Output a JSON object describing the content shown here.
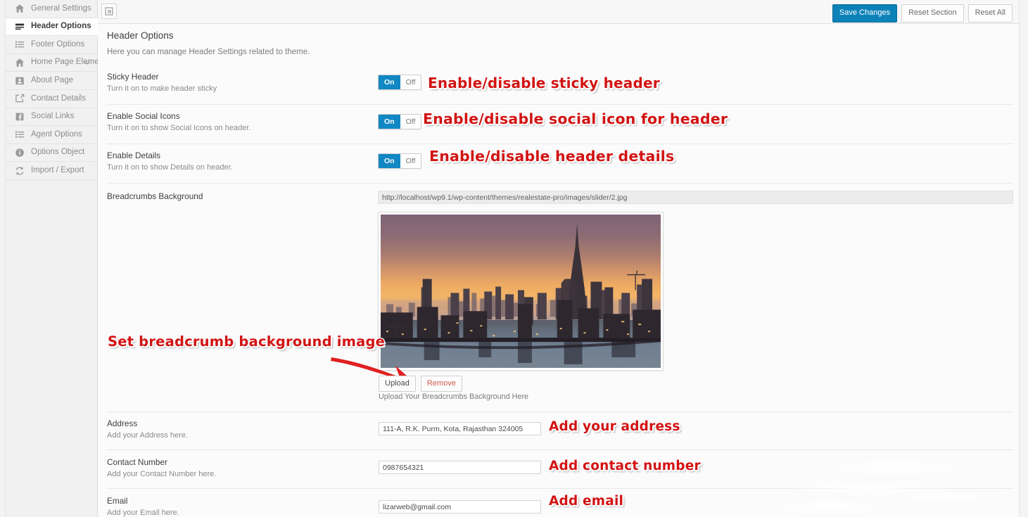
{
  "sidebar": {
    "items": [
      {
        "label": "General Settings",
        "icon": "home-icon",
        "active": false,
        "chevron": false
      },
      {
        "label": "Header Options",
        "icon": "header-bars-icon",
        "active": true,
        "chevron": false
      },
      {
        "label": "Footer Options",
        "icon": "list-icon",
        "active": false,
        "chevron": false
      },
      {
        "label": "Home Page Element",
        "icon": "home-icon",
        "active": false,
        "chevron": true
      },
      {
        "label": "About Page",
        "icon": "id-card-icon",
        "active": false,
        "chevron": false
      },
      {
        "label": "Contact Details",
        "icon": "edit-square-icon",
        "active": false,
        "chevron": false
      },
      {
        "label": "Social Links",
        "icon": "facebook-icon",
        "active": false,
        "chevron": false
      },
      {
        "label": "Agent Options",
        "icon": "list-icon",
        "active": false,
        "chevron": false
      },
      {
        "label": "Options Object",
        "icon": "info-circle-icon",
        "active": false,
        "chevron": false
      },
      {
        "label": "Import / Export",
        "icon": "refresh-icon",
        "active": false,
        "chevron": false
      }
    ]
  },
  "topbar": {
    "expand_icon": "panel-square-icon",
    "save_label": "Save Changes",
    "reset_section_label": "Reset Section",
    "reset_all_label": "Reset All"
  },
  "page": {
    "title": "Header Options",
    "subtitle": "Here you can manage Header Settings related to theme."
  },
  "toggle": {
    "on_label": "On",
    "off_label": "Off"
  },
  "fields": {
    "sticky_header": {
      "title": "Sticky Header",
      "desc": "Turn it on to make header sticky",
      "value": "On",
      "annotation": "Enable/disable sticky header"
    },
    "enable_social_icons": {
      "title": "Enable Social Icons",
      "desc": "Turn it on to show Social Icons on header.",
      "value": "On",
      "annotation": "Enable/disable social icon for header"
    },
    "enable_details": {
      "title": "Enable Details",
      "desc": "Turn it on to show Details on header.",
      "value": "On",
      "annotation": "Enable/disable header details"
    },
    "breadcrumbs_background": {
      "title": "Breadcrumbs Background",
      "url": "http://localhost/wp9.1/wp-content/themes/realestate-pro/images/slider/2.jpg",
      "upload_label": "Upload",
      "remove_label": "Remove",
      "note": "Upload Your Breadcrumbs Background Here",
      "annotation": "Set breadcrumb background image",
      "preview_alt": "Dubai skyline at sunset over water"
    },
    "address": {
      "title": "Address",
      "desc": "Add your Address here.",
      "value": "111-A, R.K. Purm, Kota, Rajasthan 324005",
      "annotation": "Add your address"
    },
    "contact_number": {
      "title": "Contact Number",
      "desc": "Add your Contact Number here.",
      "value": "0987654321",
      "annotation": "Add contact number"
    },
    "email": {
      "title": "Email",
      "desc": "Add your Email here.",
      "value": "lizarweb@gmail.com",
      "annotation": "Add email"
    }
  },
  "colors": {
    "accent_blue": "#1187c4",
    "annotation_red": "#d21313",
    "sidebar_bg": "#f1f1f1",
    "panel_bg": "#fbfbfb"
  }
}
